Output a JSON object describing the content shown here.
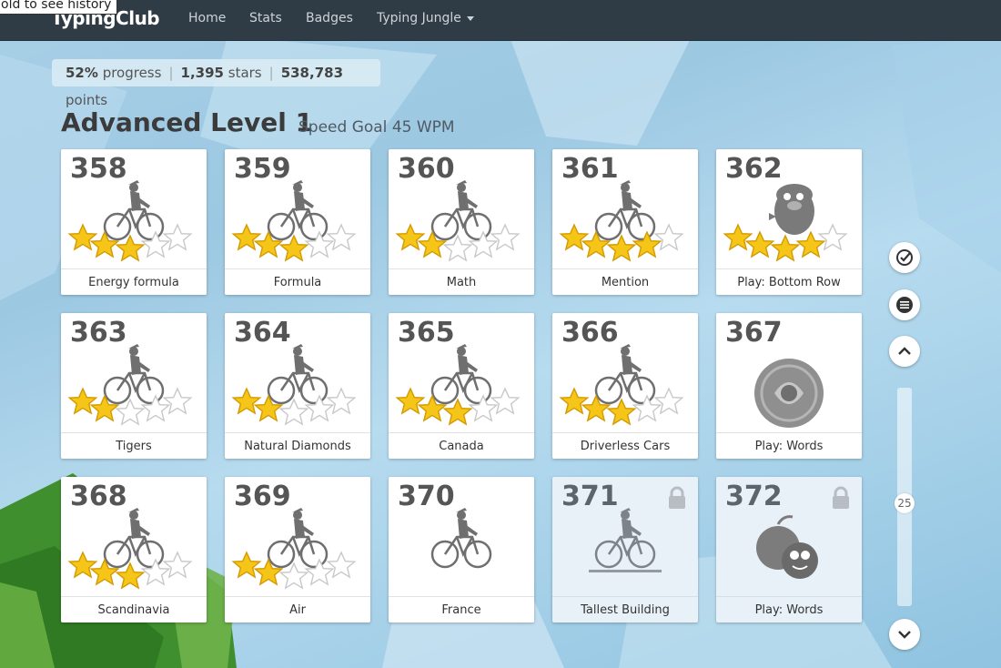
{
  "app": {
    "brand": "TypingClub",
    "history_tip": "old to see history"
  },
  "nav": {
    "home": "Home",
    "stats": "Stats",
    "badges": "Badges",
    "jungle": "Typing Jungle"
  },
  "progress": {
    "percent": "52%",
    "percent_word": "progress",
    "stars": "1,395",
    "stars_word": "stars",
    "points": "538,783",
    "points_word": "points",
    "separator": "|"
  },
  "level": {
    "title": "Advanced Level 1",
    "speed_goal": "Speed Goal 45 WPM"
  },
  "tiles": [
    {
      "num": "358",
      "label": "Energy formula",
      "art": "cyclist-icon",
      "stars": 3,
      "locked": false
    },
    {
      "num": "359",
      "label": "Formula",
      "art": "cyclist-icon",
      "stars": 3,
      "locked": false
    },
    {
      "num": "360",
      "label": "Math",
      "art": "cyclist-icon",
      "stars": 2,
      "locked": false
    },
    {
      "num": "361",
      "label": "Mention",
      "art": "cyclist-icon",
      "stars": 4,
      "locked": false
    },
    {
      "num": "362",
      "label": "Play: Bottom Row",
      "art": "creature-icon",
      "stars": 4,
      "locked": false
    },
    {
      "num": "363",
      "label": "Tigers",
      "art": "cyclist-icon",
      "stars": 2,
      "locked": false
    },
    {
      "num": "364",
      "label": "Natural Diamonds",
      "art": "cyclist-icon",
      "stars": 2,
      "locked": false
    },
    {
      "num": "365",
      "label": "Canada",
      "art": "cyclist-icon",
      "stars": 3,
      "locked": false
    },
    {
      "num": "366",
      "label": "Driverless Cars",
      "art": "cyclist-icon",
      "stars": 3,
      "locked": false
    },
    {
      "num": "367",
      "label": "Play: Words",
      "art": "game-coin-icon",
      "stars": 0,
      "locked": false
    },
    {
      "num": "368",
      "label": "Scandinavia",
      "art": "cyclist-icon",
      "stars": 3,
      "locked": false
    },
    {
      "num": "369",
      "label": "Air",
      "art": "cyclist-icon",
      "stars": 2,
      "locked": false
    },
    {
      "num": "370",
      "label": "France",
      "art": "cyclist-icon",
      "stars": 0,
      "locked": false
    },
    {
      "num": "371",
      "label": "Tallest Building",
      "art": "cyclist-icon",
      "stars": 0,
      "locked": true
    },
    {
      "num": "372",
      "label": "Play: Words",
      "art": "apple-game-icon",
      "stars": 0,
      "locked": true
    }
  ],
  "sidebar": {
    "check_icon": "check-circle-icon",
    "menu_icon": "hamburger-menu-icon",
    "up_icon": "chevron-up-icon",
    "down_icon": "chevron-down-icon",
    "scroll_marker": "25"
  },
  "colors": {
    "navbar": "#2f3b45",
    "star_fill": "#f5c518",
    "star_empty": "#ffffff",
    "accent": "#3b3b3b"
  }
}
